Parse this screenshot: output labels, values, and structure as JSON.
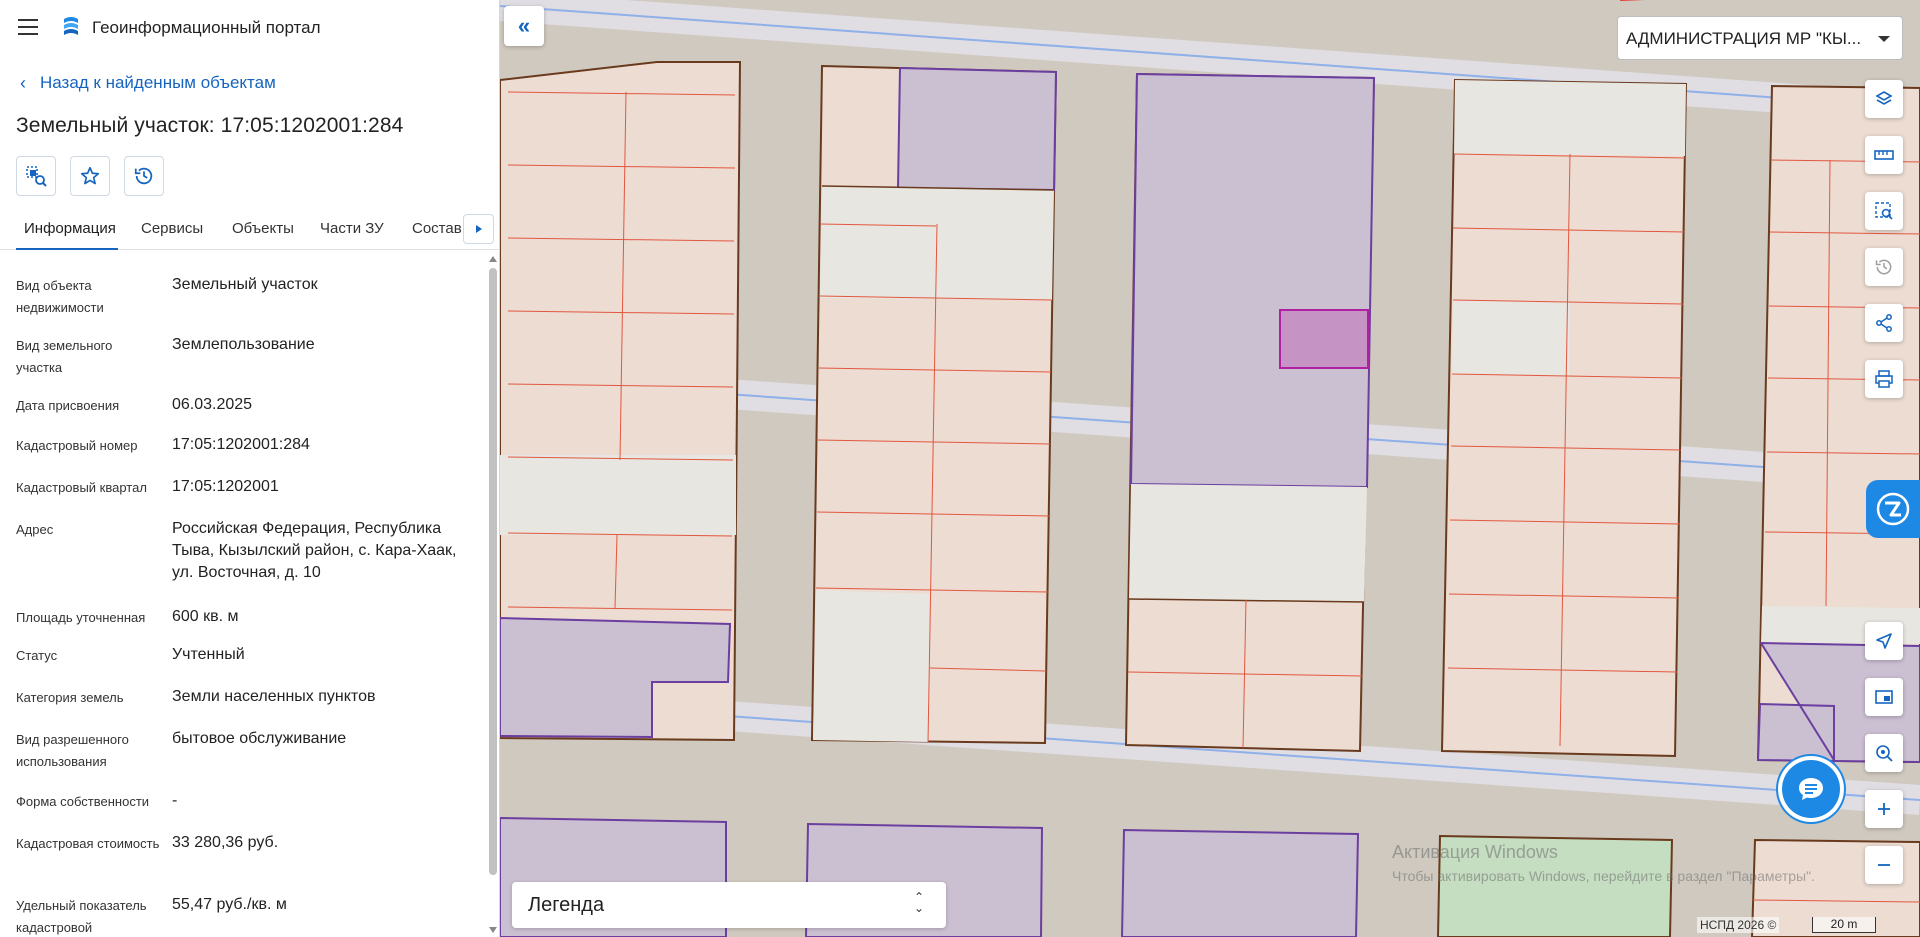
{
  "header": {
    "app_title": "Геоинформационный портал",
    "menu_icon": "hamburger-icon",
    "logo_icon": "portal-logo-icon"
  },
  "back_link": {
    "label": "Назад к найденным объектам"
  },
  "object": {
    "title": "Земельный участок: 17:05:1202001:284"
  },
  "actions": [
    {
      "icon": "map-search-icon"
    },
    {
      "icon": "star-icon"
    },
    {
      "icon": "history-icon"
    }
  ],
  "tabs": [
    {
      "label": "Информация",
      "active": true
    },
    {
      "label": "Сервисы"
    },
    {
      "label": "Объекты"
    },
    {
      "label": "Части ЗУ"
    },
    {
      "label": "Состав"
    }
  ],
  "properties": [
    {
      "label": "Вид объекта недвижимости",
      "value": "Земельный участок"
    },
    {
      "label": "Вид земельного участка",
      "value": "Землепользование"
    },
    {
      "label": "Дата присвоения",
      "value": "06.03.2025"
    },
    {
      "label": "Кадастровый номер",
      "value": "17:05:1202001:284"
    },
    {
      "label": "Кадастровый квартал",
      "value": "17:05:1202001"
    },
    {
      "label": "Адрес",
      "value": "Российская Федерация, Республика Тыва, Кызылский район, с. Кара-Хаак, ул. Восточная, д. 10"
    },
    {
      "label": "Площадь уточненная",
      "value": "600 кв. м"
    },
    {
      "label": "Статус",
      "value": "Учтенный"
    },
    {
      "label": "Категория земель",
      "value": "Земли населенных пунктов"
    },
    {
      "label": "Вид разрешенного использования",
      "value": "бытовое обслуживание"
    },
    {
      "label": "Форма собственности",
      "value": "-"
    },
    {
      "label": "Кадастровая стоимость",
      "value": "33 280,36 руб."
    },
    {
      "label": "Удельный показатель кадастровой",
      "value": "55,47 руб./кв. м"
    }
  ],
  "map": {
    "org_select": "АДМИНИСТРАЦИЯ МР \"КЫ...",
    "tools": [
      "layers-icon",
      "ruler-icon",
      "area-select-icon",
      "history-icon",
      "share-icon",
      "print-icon",
      "locate-icon",
      "minimap-icon",
      "geolocation-icon",
      "zoom-in-icon",
      "zoom-out-icon"
    ],
    "legend_title": "Легенда",
    "watermark_title": "Активация Windows",
    "watermark_text": "Чтобы активировать Windows, перейдите в раздел \"Параметры\".",
    "attribution": "НСПД 2026 ©",
    "scale_label": "20 m",
    "colors": {
      "background": "#cfc9bf",
      "parcel_fill": "#ecdcd2",
      "parcel_stroke": "#e2573f",
      "block_stroke": "#6a3a1e",
      "zone_purple": "#cbbfd2",
      "zone_purple_stroke": "#6b3fa0",
      "selected_fill": "#c594c4",
      "selected_stroke": "#b020a0",
      "green_zone": "#c5ddc0",
      "road_line": "#8fb0e8",
      "accent": "#1e88e5"
    }
  }
}
